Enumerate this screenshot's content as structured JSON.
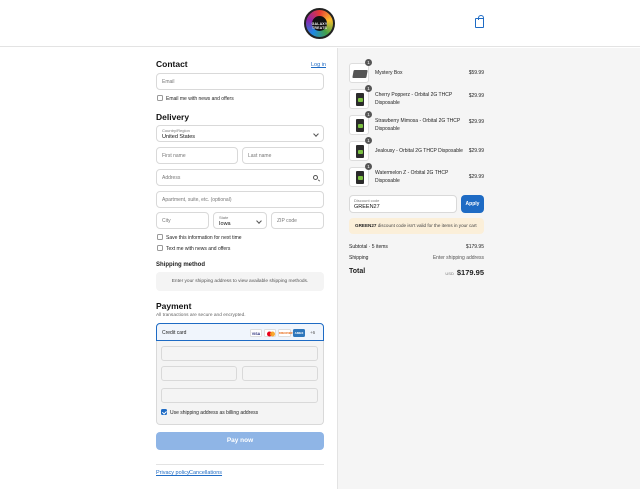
{
  "header": {
    "logo_alt": "GALAXY TREATS",
    "cart_icon": "shopping-bag-icon"
  },
  "contact": {
    "heading": "Contact",
    "login_link": "Log in",
    "email_placeholder": "Email",
    "news_label": "Email me with news and offers"
  },
  "delivery": {
    "heading": "Delivery",
    "country_label": "Country/Region",
    "country_value": "United States",
    "first_name_placeholder": "First name",
    "last_name_placeholder": "Last name",
    "address_placeholder": "Address",
    "apartment_placeholder": "Apartment, suite, etc. (optional)",
    "city_placeholder": "City",
    "state_label": "State",
    "state_value": "Iowa",
    "zip_placeholder": "ZIP code",
    "save_info_label": "Save this information for next time",
    "text_news_label": "Text me with news and offers"
  },
  "shipping_method": {
    "heading": "Shipping method",
    "message": "Enter your shipping address to view available shipping methods."
  },
  "payment": {
    "heading": "Payment",
    "subtitle": "All transactions are secure and encrypted.",
    "credit_card_label": "Credit card",
    "card_brands": [
      "VISA",
      "MC",
      "DISCOVER",
      "AMEX",
      "+6"
    ],
    "billing_same_label": "Use shipping address as billing address",
    "pay_button": "Pay now"
  },
  "footer": {
    "privacy": "Privacy policy",
    "cancellations": "Cancellations"
  },
  "order": {
    "items": [
      {
        "name": "Mystery Box",
        "price": "$59.99",
        "qty": "1"
      },
      {
        "name": "Cherry Popperz - Orbital 2G THCP Disposable",
        "price": "$29.99",
        "qty": "1"
      },
      {
        "name": "Strawberry Mimosa - Orbital 2G THCP Disposable",
        "price": "$29.99",
        "qty": "1"
      },
      {
        "name": "Jealousy - Orbital 2G THCP Disposable",
        "price": "$29.99",
        "qty": "1"
      },
      {
        "name": "Watermelon Z - Orbital 2G THCP Disposable",
        "price": "$29.99",
        "qty": "1"
      }
    ],
    "discount_label": "Discount code",
    "discount_value": "GREEN27",
    "apply_button": "Apply",
    "warning_code": "GREEN27",
    "warning_text": " discount code isn't valid for the items in your cart",
    "subtotal_label": "Subtotal · 5 items",
    "subtotal_value": "$179.95",
    "shipping_label": "Shipping",
    "shipping_value": "Enter shipping address",
    "total_label": "Total",
    "currency": "USD",
    "total_value": "$179.95"
  },
  "colors": {
    "accent": "#1e6bc4",
    "pay_button_disabled": "#8fb5e6",
    "warning_bg": "#fbefd9",
    "summary_bg": "#f5f5f5"
  }
}
